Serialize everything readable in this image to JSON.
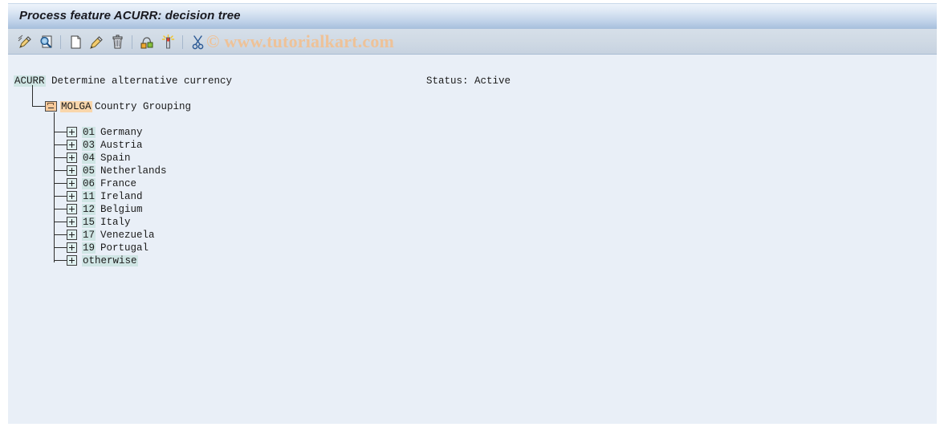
{
  "window": {
    "title": "Process feature ACURR: decision tree"
  },
  "toolbar": {
    "buttons": [
      {
        "name": "display-change-icon",
        "title": "Display <-> Change"
      },
      {
        "name": "search-document-icon",
        "title": "Display"
      },
      {
        "name": "create-document-icon",
        "title": "Create"
      },
      {
        "name": "edit-pencil-icon",
        "title": "Change"
      },
      {
        "name": "delete-trash-icon",
        "title": "Delete"
      },
      {
        "name": "copy-node-icon",
        "title": "Copy"
      },
      {
        "name": "highlight-node-icon",
        "title": "Insert node"
      },
      {
        "name": "cut-scissors-icon",
        "title": "Cut"
      }
    ],
    "watermark": "© www.tutorialkart.com"
  },
  "header": {
    "feature_code": "ACURR",
    "feature_description": "Determine alternative currency",
    "status": "Status: Active"
  },
  "tree": {
    "group": {
      "code": "MOLGA",
      "description": "Country Grouping"
    },
    "leaves": [
      {
        "code": "01",
        "description": "Germany"
      },
      {
        "code": "03",
        "description": "Austria"
      },
      {
        "code": "04",
        "description": "Spain"
      },
      {
        "code": "05",
        "description": "Netherlands"
      },
      {
        "code": "06",
        "description": "France"
      },
      {
        "code": "11",
        "description": "Ireland"
      },
      {
        "code": "12",
        "description": "Belgium"
      },
      {
        "code": "15",
        "description": "Italy"
      },
      {
        "code": "17",
        "description": "Venezuela"
      },
      {
        "code": "19",
        "description": "Portugal"
      },
      {
        "code": "otherwise",
        "description": ""
      }
    ]
  },
  "colors": {
    "title_bar_bottom": "#a6bfdc",
    "toolbar_bg": "#cfd9e4",
    "content_bg": "#e9eff7",
    "code_highlight": "#cfe5e4",
    "group_highlight": "#f9d6ab",
    "watermark": "#eec298"
  }
}
